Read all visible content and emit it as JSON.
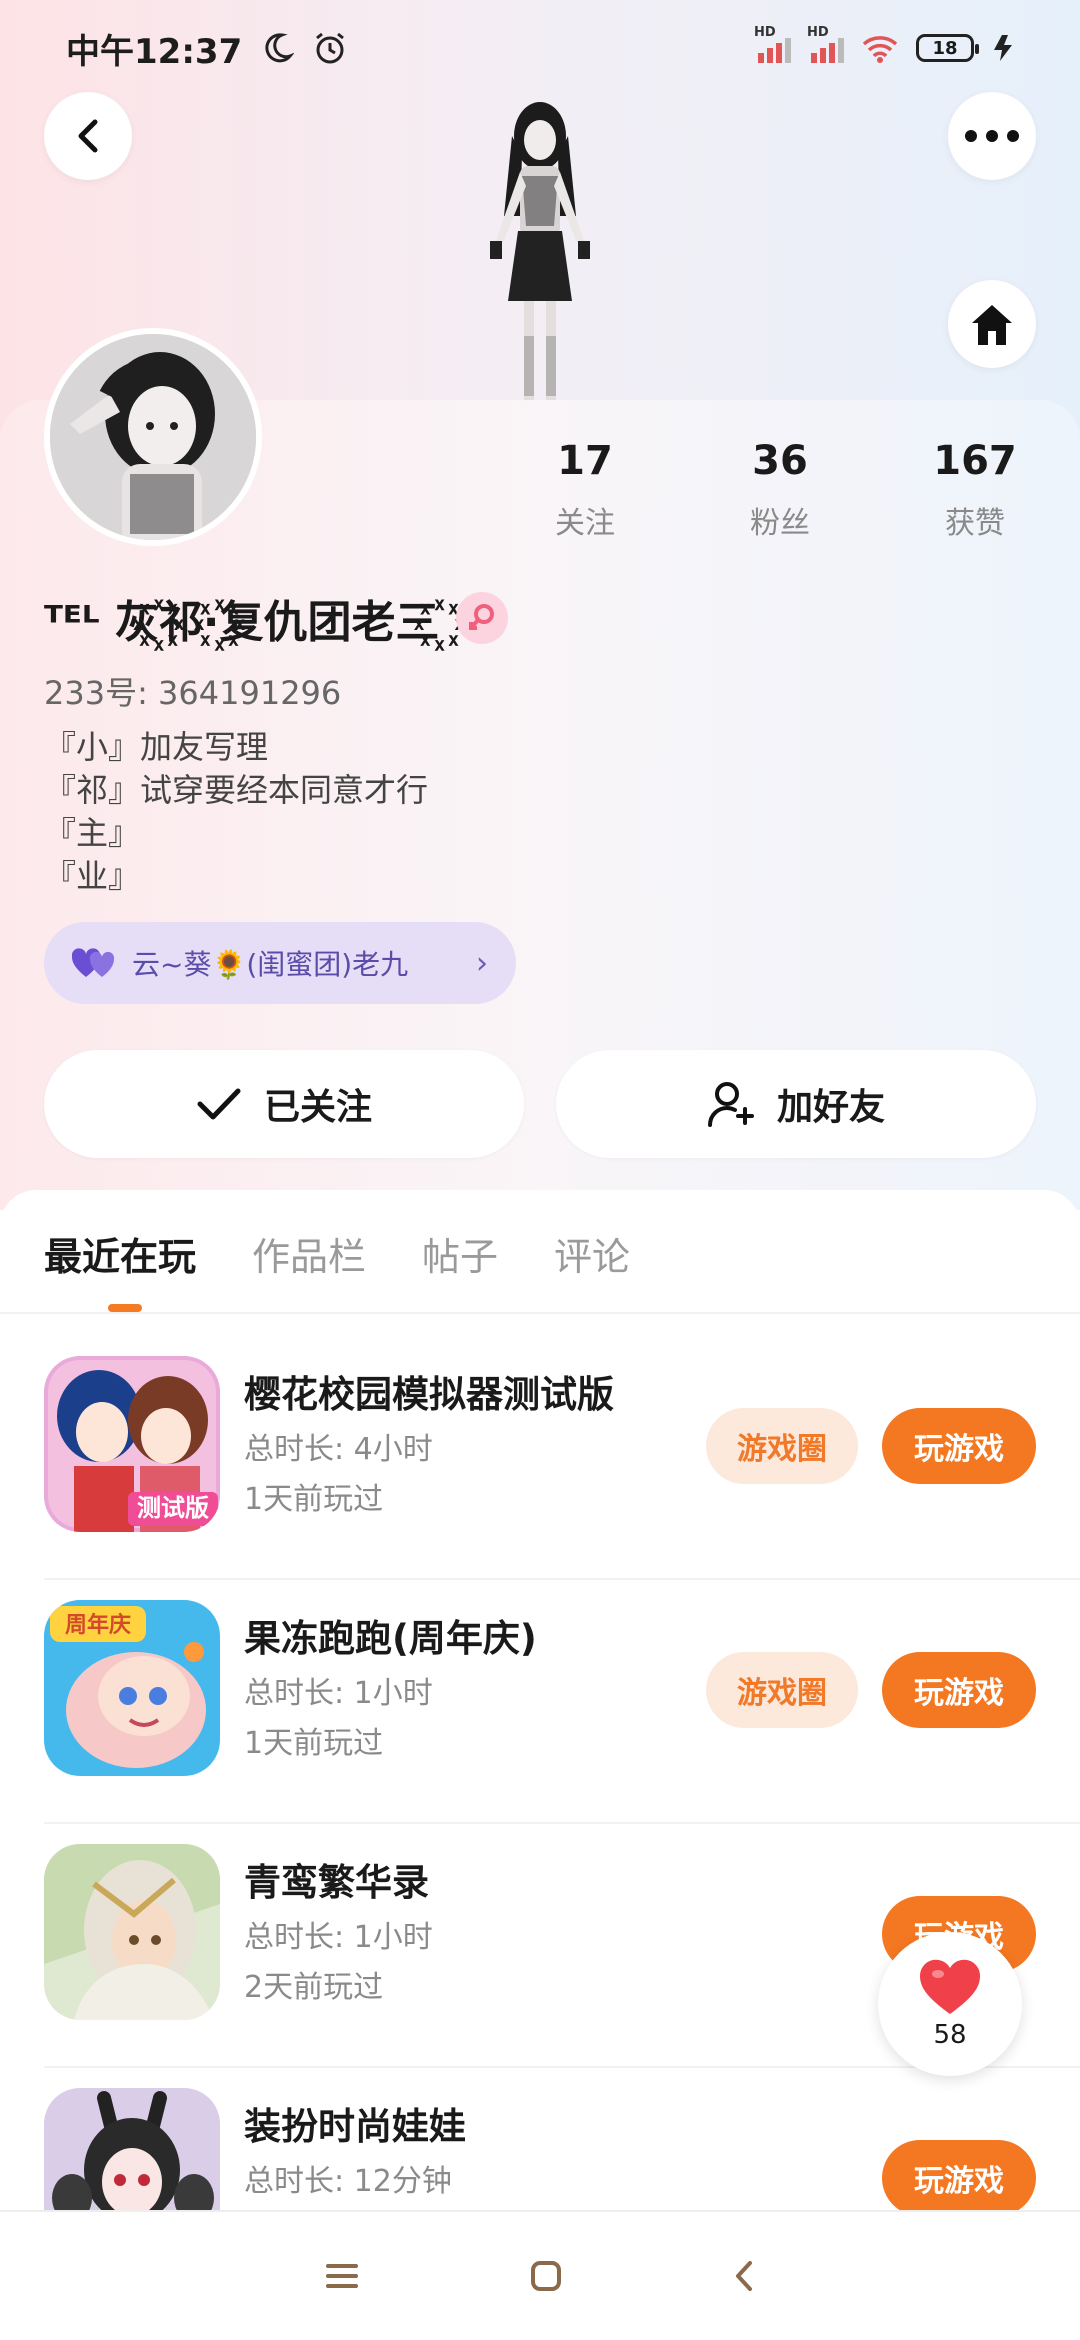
{
  "status_bar": {
    "time": "中午12:37",
    "battery": "18",
    "net_label_1": "HD",
    "net_label_2": "HD"
  },
  "header": {
    "back_icon": "chevron-left-icon",
    "more_icon": "more-dots-icon",
    "home_icon": "house-icon"
  },
  "profile": {
    "nickname": "ᵀᴱᴸ 灰꙰祁·꙰复仇团老三꙰",
    "gender": "female",
    "uid": "233号: 364191296",
    "stats": [
      {
        "value": "17",
        "label": "关注"
      },
      {
        "value": "36",
        "label": "粉丝"
      },
      {
        "value": "167",
        "label": "获赞"
      }
    ],
    "bio": [
      "『小』加友写理",
      "『祁』试穿要经本同意才行",
      "『主』",
      "『业』"
    ],
    "cp_chip": "云~葵🌻(闺蜜团)老九",
    "followed_label": "已关注",
    "add_friend_label": "加好友"
  },
  "tabs": [
    {
      "label": "最近在玩",
      "active": true
    },
    {
      "label": "作品栏",
      "active": false
    },
    {
      "label": "帖子",
      "active": false
    },
    {
      "label": "评论",
      "active": false
    }
  ],
  "games": [
    {
      "title": "樱花校园模拟器测试版",
      "duration": "总时长: 4小时",
      "last_played": "1天前玩过",
      "circle_label": "游戏圈",
      "play_label": "玩游戏",
      "has_circle": true
    },
    {
      "title": "果冻跑跑(周年庆)",
      "duration": "总时长: 1小时",
      "last_played": "1天前玩过",
      "circle_label": "游戏圈",
      "play_label": "玩游戏",
      "has_circle": true
    },
    {
      "title": "青鸾繁华录",
      "duration": "总时长: 1小时",
      "last_played": "2天前玩过",
      "play_label": "玩游戏",
      "has_circle": false
    },
    {
      "title": "装扮时尚娃娃",
      "duration": "总时长: 12分钟",
      "last_played": "",
      "play_label": "玩游戏",
      "has_circle": false
    }
  ],
  "icon_text": {
    "game_1_badge": "测试版",
    "game_2_badge": "周年庆"
  },
  "like_fab": {
    "count": "58"
  },
  "colors": {
    "accent": "#f47821",
    "accent_soft": "#fde8dc",
    "chip_bg": "#e5def6",
    "like_red": "#f0404a"
  }
}
